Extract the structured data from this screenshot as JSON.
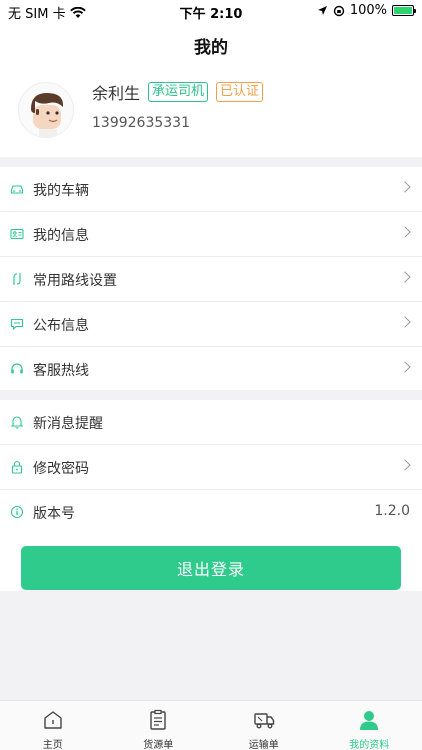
{
  "status_bar": {
    "carrier": "无 SIM 卡",
    "time": "下午 2:10",
    "battery": "100%",
    "battery_level": 1.0
  },
  "header": {
    "title": "我的"
  },
  "profile": {
    "name": "余利生",
    "role_tag": "承运司机",
    "verify_tag": "已认证",
    "phone": "13992635331"
  },
  "menu_group1": [
    {
      "label": "我的车辆",
      "icon": "car-icon"
    },
    {
      "label": "我的信息",
      "icon": "id-card-icon"
    },
    {
      "label": "常用路线设置",
      "icon": "route-icon"
    },
    {
      "label": "公布信息",
      "icon": "message-icon"
    },
    {
      "label": "客服热线",
      "icon": "headset-icon"
    }
  ],
  "menu_group2": [
    {
      "label": "新消息提醒",
      "icon": "bell-icon"
    },
    {
      "label": "修改密码",
      "icon": "lock-icon"
    },
    {
      "label": "版本号",
      "icon": "info-icon",
      "value": "1.2.0"
    }
  ],
  "logout_label": "退出登录",
  "tabs": [
    {
      "label": "主页",
      "icon": "home-icon"
    },
    {
      "label": "货源单",
      "icon": "document-icon"
    },
    {
      "label": "运输单",
      "icon": "truck-icon"
    },
    {
      "label": "我的资料",
      "icon": "user-icon",
      "active": true
    }
  ],
  "colors": {
    "accent": "#2ecb8c",
    "tag_green": "#2ec28a",
    "tag_orange": "#f0a04b"
  }
}
